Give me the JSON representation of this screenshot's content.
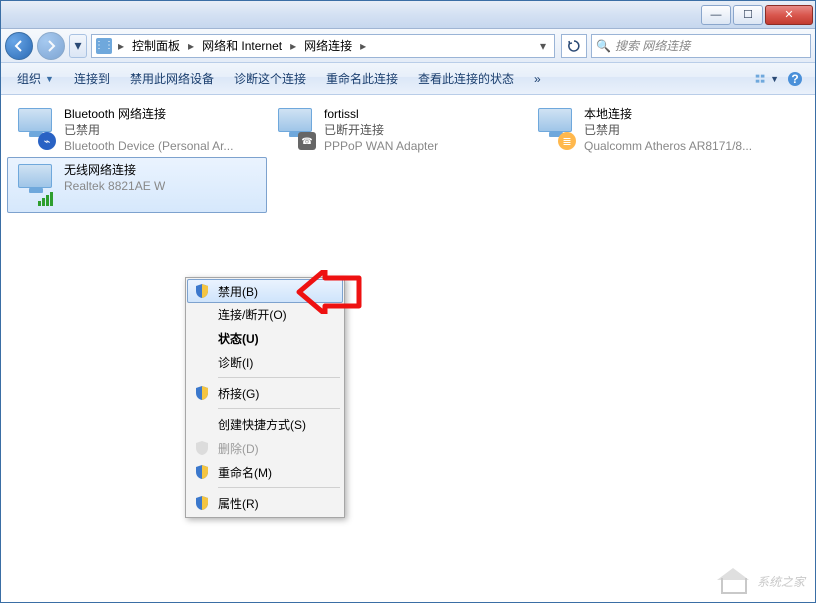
{
  "breadcrumb": {
    "root_icon": "network-location-icon",
    "items": [
      "控制面板",
      "网络和 Internet",
      "网络连接"
    ]
  },
  "search": {
    "placeholder": "搜索 网络连接"
  },
  "toolbar": {
    "organize": "组织",
    "connect_to": "连接到",
    "disable_device": "禁用此网络设备",
    "diagnose": "诊断这个连接",
    "rename": "重命名此连接",
    "view_status": "查看此连接的状态",
    "more": "»"
  },
  "connections": [
    {
      "name": "Bluetooth 网络连接",
      "status": "已禁用",
      "device": "Bluetooth Device (Personal Ar...",
      "overlay": "bt",
      "selected": false
    },
    {
      "name": "fortissl",
      "status": "已断开连接",
      "device": "PPPoP WAN Adapter",
      "overlay": "phone",
      "selected": false
    },
    {
      "name": "本地连接",
      "status": "已禁用",
      "device": "Qualcomm Atheros AR8171/8...",
      "overlay": "cable",
      "selected": false
    },
    {
      "name": "无线网络连接",
      "status": "",
      "device": "Realtek 8821AE W",
      "overlay": "wifi",
      "selected": true
    }
  ],
  "context_menu": {
    "items": [
      {
        "label": "禁用(B)",
        "shield": true,
        "hover": true
      },
      {
        "label": "连接/断开(O)",
        "shield": false
      },
      {
        "label": "状态(U)",
        "bold": true
      },
      {
        "label": "诊断(I)"
      },
      {
        "sep": true
      },
      {
        "label": "桥接(G)",
        "shield": true
      },
      {
        "sep": true
      },
      {
        "label": "创建快捷方式(S)"
      },
      {
        "label": "删除(D)",
        "shield": true,
        "disabled": true
      },
      {
        "label": "重命名(M)",
        "shield": true
      },
      {
        "sep": true
      },
      {
        "label": "属性(R)",
        "shield": true
      }
    ]
  },
  "watermark": "系统之家"
}
